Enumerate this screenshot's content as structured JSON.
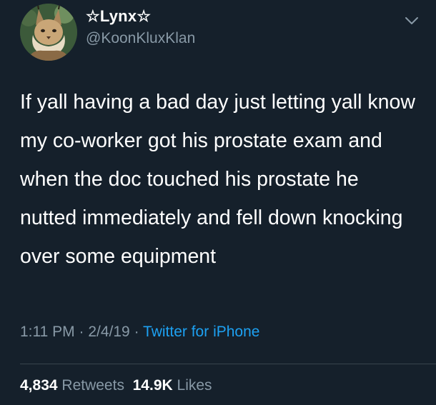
{
  "author": {
    "display_name": "☆Lynx☆",
    "handle": "@KoonKluxKlan",
    "avatar_icon": "lynx-avatar"
  },
  "tweet": {
    "text": "If yall having a bad day just letting yall know my co-worker got his prostate exam and when the doc touched his prostate he nutted immediately and fell down knocking over some equipment",
    "time": "1:11 PM",
    "date": "2/4/19",
    "source": "Twitter for iPhone",
    "separator": "·"
  },
  "stats": {
    "retweets_count": "4,834",
    "retweets_label": "Retweets",
    "likes_count": "14.9K",
    "likes_label": "Likes"
  },
  "colors": {
    "background": "#15202b",
    "text": "#ffffff",
    "muted": "#8899a6",
    "link": "#1da1f2"
  }
}
